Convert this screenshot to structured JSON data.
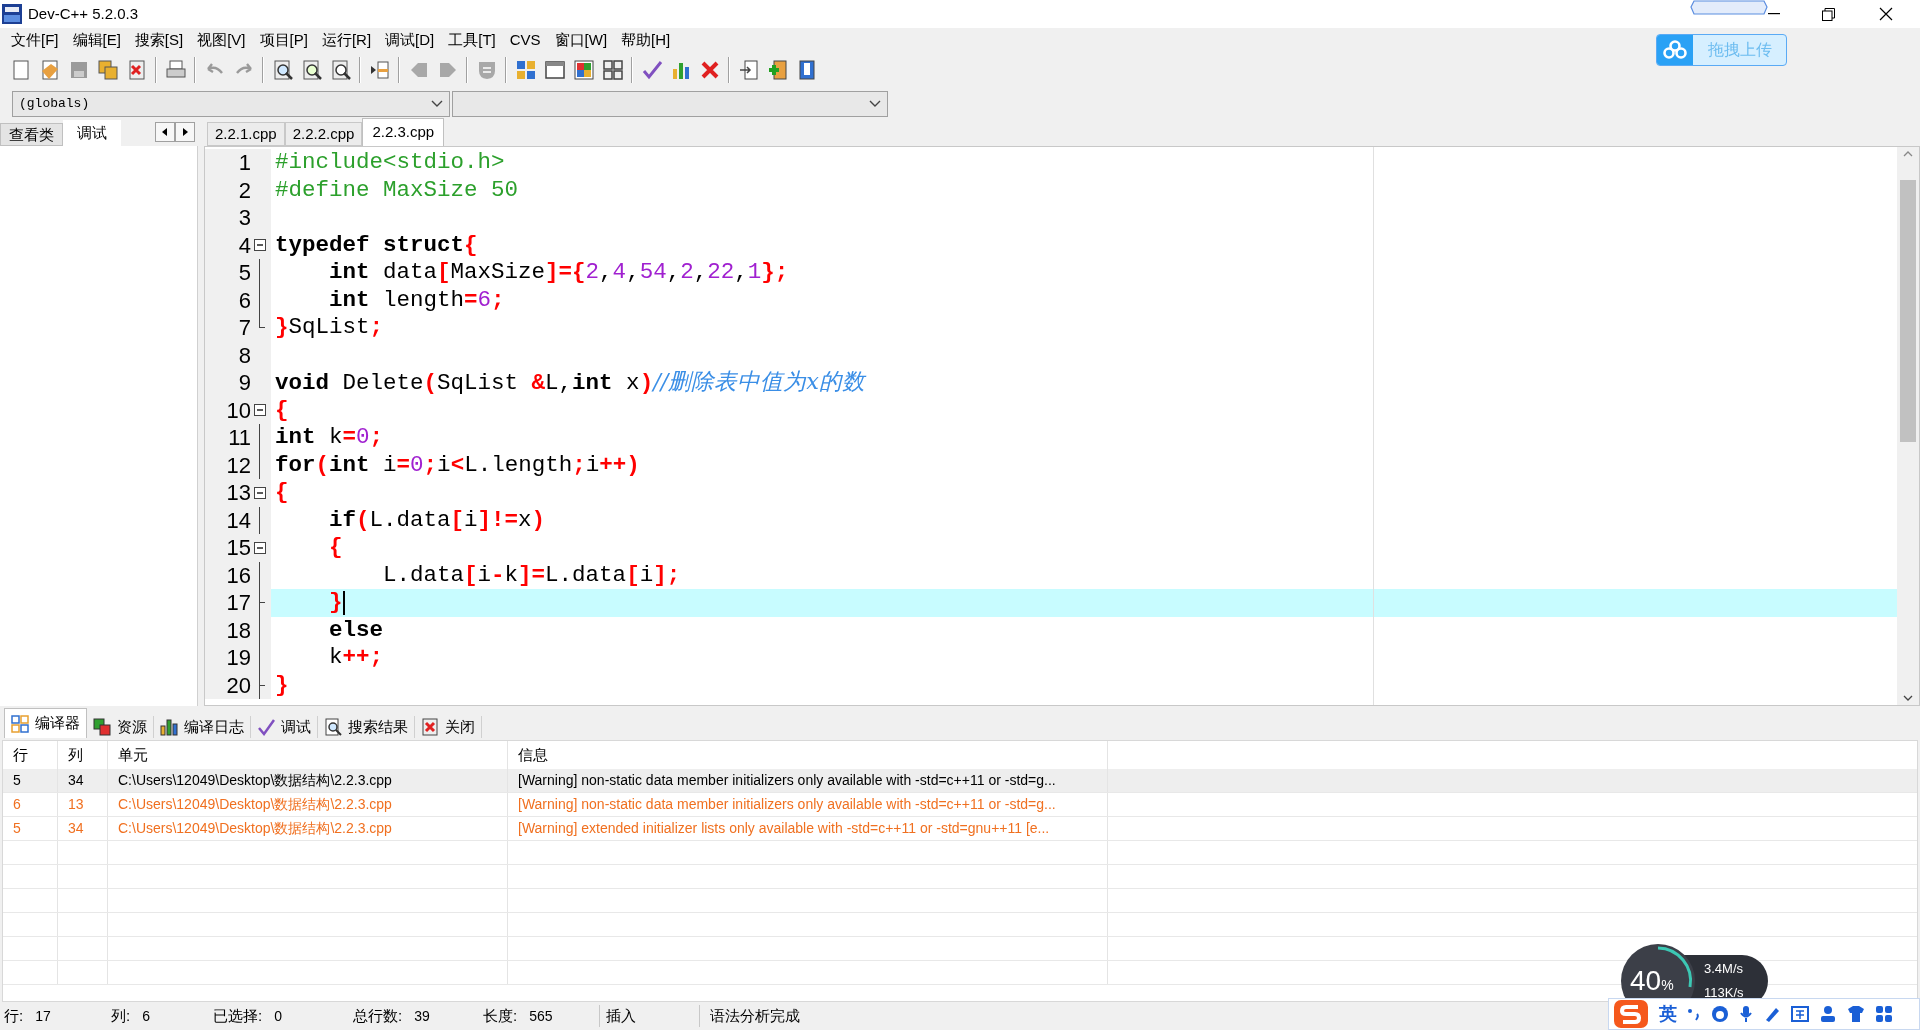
{
  "window": {
    "title": "Dev-C++ 5.2.0.3"
  },
  "menu": [
    "文件[F]",
    "编辑[E]",
    "搜索[S]",
    "视图[V]",
    "项目[P]",
    "运行[R]",
    "调试[D]",
    "工具[T]",
    "CVS",
    "窗口[W]",
    "帮助[H]"
  ],
  "upload_button": {
    "label": "拖拽上传"
  },
  "scope_combo": {
    "value": "(globals)"
  },
  "side_tabs": [
    {
      "label": "查看类",
      "selected": false
    },
    {
      "label": "调试",
      "selected": true
    }
  ],
  "editor_tabs": [
    {
      "label": "2.2.1.cpp",
      "selected": false
    },
    {
      "label": "2.2.2.cpp",
      "selected": false
    },
    {
      "label": "2.2.3.cpp",
      "selected": true
    }
  ],
  "code_lines": [
    {
      "number": "1",
      "kind": "plain",
      "current": false,
      "tokens": [
        {
          "kind": "preproc",
          "text": "#include<stdio.h>"
        }
      ]
    },
    {
      "number": "2",
      "kind": "plain",
      "current": false,
      "tokens": [
        {
          "kind": "preproc",
          "text": "#define MaxSize 50"
        }
      ]
    },
    {
      "number": "3",
      "kind": "plain",
      "current": false
    },
    {
      "number": "4",
      "kind": "fold-open",
      "current": false,
      "tokens": [
        {
          "kind": "keyword",
          "text": "typedef"
        },
        {
          "kind": "keyword",
          "text": " struct"
        },
        {
          "kind": "symbol",
          "text": "{"
        }
      ]
    },
    {
      "number": "5",
      "kind": "fold-bar",
      "current": false,
      "tokens": [
        {
          "kind": "keyword",
          "text": "    int"
        },
        {
          "kind": "plain",
          "text": " data"
        },
        {
          "kind": "symbol",
          "text": "["
        },
        {
          "kind": "plain",
          "text": "MaxSize"
        },
        {
          "kind": "symbol",
          "text": "]={"
        },
        {
          "kind": "number",
          "text": "2"
        },
        {
          "kind": "plain",
          "text": ","
        },
        {
          "kind": "number",
          "text": "4"
        },
        {
          "kind": "plain",
          "text": ","
        },
        {
          "kind": "number",
          "text": "54"
        },
        {
          "kind": "plain",
          "text": ","
        },
        {
          "kind": "number",
          "text": "2"
        },
        {
          "kind": "plain",
          "text": ","
        },
        {
          "kind": "number",
          "text": "22"
        },
        {
          "kind": "plain",
          "text": ","
        },
        {
          "kind": "number",
          "text": "1"
        },
        {
          "kind": "symbol",
          "text": "};"
        }
      ]
    },
    {
      "number": "6",
      "kind": "fold-bar",
      "current": false,
      "tokens": [
        {
          "kind": "keyword",
          "text": "    int"
        },
        {
          "kind": "plain",
          "text": " length"
        },
        {
          "kind": "symbol",
          "text": "="
        },
        {
          "kind": "number",
          "text": "6"
        },
        {
          "kind": "symbol",
          "text": ";"
        }
      ]
    },
    {
      "number": "7",
      "kind": "fold-end",
      "current": false,
      "tokens": [
        {
          "kind": "symbol",
          "text": "}"
        },
        {
          "kind": "plain",
          "text": "SqList"
        },
        {
          "kind": "symbol",
          "text": ";"
        }
      ]
    },
    {
      "number": "8",
      "kind": "plain",
      "current": false
    },
    {
      "number": "9",
      "kind": "plain",
      "current": false,
      "tokens": [
        {
          "kind": "keyword",
          "text": "void"
        },
        {
          "kind": "plain",
          "text": " Delete"
        },
        {
          "kind": "symbol",
          "text": "("
        },
        {
          "kind": "plain",
          "text": "SqList "
        },
        {
          "kind": "symbol",
          "text": "&"
        },
        {
          "kind": "plain",
          "text": "L,"
        },
        {
          "kind": "keyword",
          "text": "int"
        },
        {
          "kind": "plain",
          "text": " x"
        },
        {
          "kind": "symbol",
          "text": ")"
        },
        {
          "kind": "comment",
          "text": "//删除表中值为x的数"
        }
      ]
    },
    {
      "number": "10",
      "kind": "fold-open",
      "current": false,
      "tokens": [
        {
          "kind": "symbol",
          "text": "{"
        }
      ]
    },
    {
      "number": "11",
      "kind": "fold-bar",
      "current": false,
      "tokens": [
        {
          "kind": "keyword",
          "text": "int"
        },
        {
          "kind": "plain",
          "text": " k"
        },
        {
          "kind": "symbol",
          "text": "="
        },
        {
          "kind": "number",
          "text": "0"
        },
        {
          "kind": "symbol",
          "text": ";"
        }
      ]
    },
    {
      "number": "12",
      "kind": "fold-bar",
      "current": false,
      "tokens": [
        {
          "kind": "keyword",
          "text": "for"
        },
        {
          "kind": "symbol",
          "text": "("
        },
        {
          "kind": "keyword",
          "text": "int"
        },
        {
          "kind": "plain",
          "text": " i"
        },
        {
          "kind": "symbol",
          "text": "="
        },
        {
          "kind": "number",
          "text": "0"
        },
        {
          "kind": "symbol",
          "text": ";"
        },
        {
          "kind": "plain",
          "text": "i"
        },
        {
          "kind": "symbol",
          "text": "<"
        },
        {
          "kind": "plain",
          "text": "L.length"
        },
        {
          "kind": "symbol",
          "text": ";"
        },
        {
          "kind": "plain",
          "text": "i"
        },
        {
          "kind": "symbol",
          "text": "++)"
        }
      ]
    },
    {
      "number": "13",
      "kind": "fold-open",
      "current": false,
      "tokens": [
        {
          "kind": "symbol",
          "text": "{"
        }
      ]
    },
    {
      "number": "14",
      "kind": "fold-bar",
      "current": false,
      "tokens": [
        {
          "kind": "keyword",
          "text": "    if"
        },
        {
          "kind": "symbol",
          "text": "("
        },
        {
          "kind": "plain",
          "text": "L.data"
        },
        {
          "kind": "symbol",
          "text": "["
        },
        {
          "kind": "plain",
          "text": "i"
        },
        {
          "kind": "symbol",
          "text": "]!="
        },
        {
          "kind": "plain",
          "text": "x"
        },
        {
          "kind": "symbol",
          "text": ")"
        }
      ]
    },
    {
      "number": "15",
      "kind": "fold-open",
      "current": false,
      "tokens": [
        {
          "kind": "symbol",
          "text": "    {"
        }
      ]
    },
    {
      "number": "16",
      "kind": "fold-bar",
      "current": false,
      "tokens": [
        {
          "kind": "plain",
          "text": "        L.data"
        },
        {
          "kind": "symbol",
          "text": "["
        },
        {
          "kind": "plain",
          "text": "i"
        },
        {
          "kind": "symbol",
          "text": "-"
        },
        {
          "kind": "plain",
          "text": "k"
        },
        {
          "kind": "symbol",
          "text": "]="
        },
        {
          "kind": "plain",
          "text": "L.data"
        },
        {
          "kind": "symbol",
          "text": "["
        },
        {
          "kind": "plain",
          "text": "i"
        },
        {
          "kind": "symbol",
          "text": "];"
        }
      ]
    },
    {
      "number": "17",
      "kind": "fold-tee",
      "current": true,
      "tokens": [
        {
          "kind": "symbol",
          "text": "    }"
        }
      ]
    },
    {
      "number": "18",
      "kind": "fold-bar",
      "current": false,
      "tokens": [
        {
          "kind": "keyword",
          "text": "    else"
        }
      ]
    },
    {
      "number": "19",
      "kind": "fold-bar",
      "current": false,
      "tokens": [
        {
          "kind": "plain",
          "text": "    k"
        },
        {
          "kind": "symbol",
          "text": "++;"
        }
      ]
    },
    {
      "number": "20",
      "kind": "fold-tee",
      "current": false,
      "tokens": [
        {
          "kind": "symbol",
          "text": "}"
        }
      ]
    }
  ],
  "bottom_tabs": [
    {
      "label": "编译器",
      "selected": true
    },
    {
      "label": "资源",
      "selected": false
    },
    {
      "label": "编译日志",
      "selected": false
    },
    {
      "label": "调试",
      "selected": false
    },
    {
      "label": "搜索结果",
      "selected": false
    },
    {
      "label": "关闭",
      "selected": false
    }
  ],
  "messages": {
    "columns": [
      "行",
      "列",
      "单元",
      "信息"
    ],
    "rows": [
      {
        "selected": true,
        "cells": [
          "5",
          "34",
          "C:\\Users\\12049\\Desktop\\数据结构\\2.2.3.cpp",
          "[Warning] non-static data member initializers only available with -std=c++11 or -std=g..."
        ]
      },
      {
        "selected": false,
        "cells": [
          "6",
          "13",
          "C:\\Users\\12049\\Desktop\\数据结构\\2.2.3.cpp",
          "[Warning] non-static data member initializers only available with -std=c++11 or -std=g..."
        ]
      },
      {
        "selected": false,
        "cells": [
          "5",
          "34",
          "C:\\Users\\12049\\Desktop\\数据结构\\2.2.3.cpp",
          "[Warning] extended initializer lists only available with -std=c++11 or -std=gnu++11 [e..."
        ]
      }
    ]
  },
  "status_bar": {
    "fields": [
      {
        "label": "行:",
        "value": "17"
      },
      {
        "label": "列:",
        "value": "6"
      },
      {
        "label": "已选择:",
        "value": "0"
      },
      {
        "label": "总行数:",
        "value": "39"
      },
      {
        "label": "长度:",
        "value": "565"
      }
    ],
    "mode": "插入",
    "message": "语法分析完成"
  },
  "speed_meter": {
    "load": "40",
    "unit": "%",
    "upload": "3.4",
    "upload_unit": "M/s",
    "download": "113",
    "download_unit": "K/s"
  },
  "ime_bar": {
    "language": "英"
  }
}
